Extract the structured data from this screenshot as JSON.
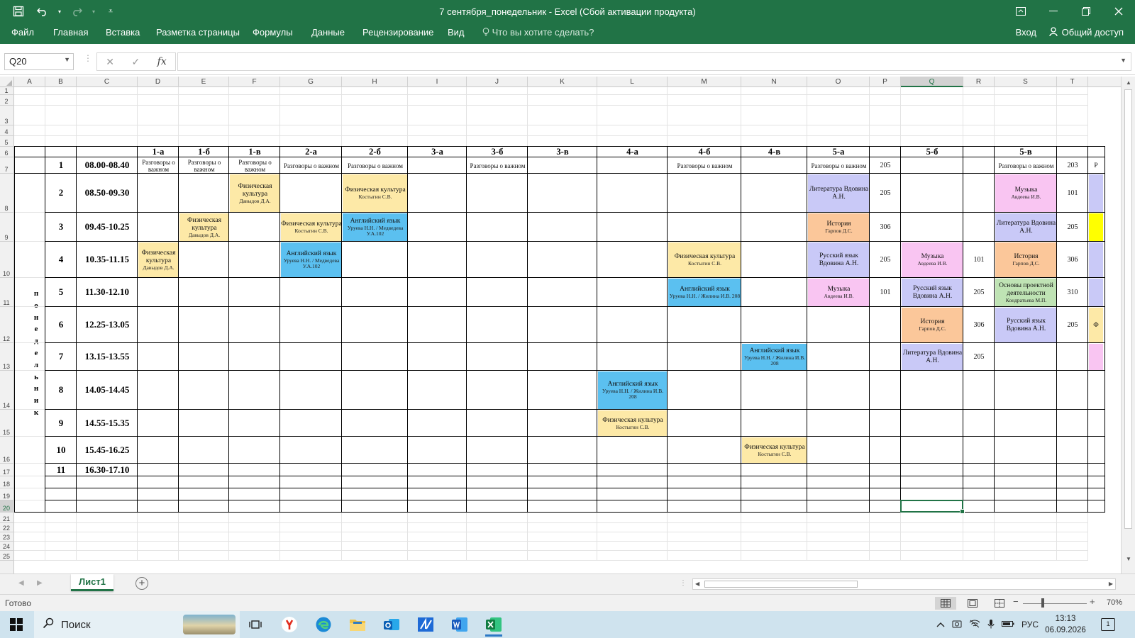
{
  "window": {
    "title": "7 сентября_понедельник - Excel (Сбой активации продукта)"
  },
  "qat": {
    "save_icon": "save-icon",
    "undo_icon": "undo-icon",
    "redo_icon": "redo-icon",
    "customize_icon": "customize-icon"
  },
  "ribbon": {
    "tabs": [
      "Файл",
      "Главная",
      "Вставка",
      "Разметка страницы",
      "Формулы",
      "Данные",
      "Рецензирование",
      "Вид"
    ],
    "tell_me": "Что вы хотите сделать?",
    "signin": "Вход",
    "share": "Общий доступ"
  },
  "formula_bar": {
    "name_box": "Q20",
    "formula": ""
  },
  "columns": [
    "A",
    "B",
    "C",
    "D",
    "E",
    "F",
    "G",
    "H",
    "I",
    "J",
    "K",
    "L",
    "M",
    "N",
    "O",
    "P",
    "Q",
    "R",
    "S",
    "T"
  ],
  "selected_column": "Q",
  "rows": [
    "1",
    "2",
    "3",
    "4",
    "5",
    "6",
    "7",
    "8",
    "9",
    "10",
    "11",
    "12",
    "13",
    "14",
    "15",
    "16",
    "17",
    "18",
    "19",
    "20",
    "21",
    "22",
    "23",
    "24",
    "25"
  ],
  "selected_row": "20",
  "schedule": {
    "day_label": "понедельник",
    "classes": [
      {
        "col": "D",
        "label": "1-а"
      },
      {
        "col": "E",
        "label": "1-б"
      },
      {
        "col": "F",
        "label": "1-в"
      },
      {
        "col": "G",
        "label": "2-а"
      },
      {
        "col": "H",
        "label": "2-б"
      },
      {
        "col": "I",
        "label": "3-а"
      },
      {
        "col": "J",
        "label": "3-б"
      },
      {
        "col": "K",
        "label": "3-в"
      },
      {
        "col": "L",
        "label": "4-а"
      },
      {
        "col": "M",
        "label": "4-б"
      },
      {
        "col": "N",
        "label": "4-в"
      },
      {
        "col": "O",
        "label": "5-а"
      },
      {
        "col": "Q",
        "label": "5-б"
      },
      {
        "col": "S",
        "label": "5-в"
      }
    ],
    "periods": [
      {
        "row": 7,
        "num": "1",
        "time": "08.00-08.40"
      },
      {
        "row": 8,
        "num": "2",
        "time": "08.50-09.30"
      },
      {
        "row": 9,
        "num": "3",
        "time": "09.45-10.25"
      },
      {
        "row": 10,
        "num": "4",
        "time": "10.35-11.15"
      },
      {
        "row": 11,
        "num": "5",
        "time": "11.30-12.10"
      },
      {
        "row": 12,
        "num": "6",
        "time": "12.25-13.05"
      },
      {
        "row": 13,
        "num": "7",
        "time": "13.15-13.55"
      },
      {
        "row": 14,
        "num": "8",
        "time": "14.05-14.45"
      },
      {
        "row": 15,
        "num": "9",
        "time": "14.55-15.35"
      },
      {
        "row": 16,
        "num": "10",
        "time": "15.45-16.25"
      },
      {
        "row": 17,
        "num": "11",
        "time": "16.30-17.10"
      }
    ],
    "lessons": [
      {
        "row": 7,
        "col": "D",
        "title": "Разговоры о важном",
        "sub": "",
        "color": "#ffffff"
      },
      {
        "row": 7,
        "col": "E",
        "title": "Разговоры о важном",
        "sub": "",
        "color": "#ffffff"
      },
      {
        "row": 7,
        "col": "F",
        "title": "Разговоры о важном",
        "sub": "",
        "color": "#ffffff"
      },
      {
        "row": 7,
        "col": "G",
        "title": "Разговоры о важном",
        "sub": "",
        "color": "#ffffff"
      },
      {
        "row": 7,
        "col": "H",
        "title": "Разговоры о важном",
        "sub": "",
        "color": "#ffffff"
      },
      {
        "row": 7,
        "col": "J",
        "title": "Разговоры о важном",
        "sub": "",
        "color": "#ffffff"
      },
      {
        "row": 7,
        "col": "M",
        "title": "Разговоры о важном",
        "sub": "",
        "color": "#ffffff"
      },
      {
        "row": 7,
        "col": "O",
        "title": "Разговоры о важном",
        "sub": "",
        "color": "#ffffff"
      },
      {
        "row": 7,
        "col": "S",
        "title": "Разговоры о важном",
        "sub": "",
        "color": "#ffffff"
      },
      {
        "row": 8,
        "col": "F",
        "title": "Физическая культура",
        "sub": "Давыдов Д.А.",
        "color": "#fde9a7"
      },
      {
        "row": 8,
        "col": "H",
        "title": "Физическая культура",
        "sub": "Костыгин С.В.",
        "color": "#fde9a7"
      },
      {
        "row": 8,
        "col": "O",
        "title": "Литература Вдовина А.Н.",
        "sub": "",
        "color": "#c9c9f7"
      },
      {
        "row": 8,
        "col": "S",
        "title": "Музыка",
        "sub": "Авдеева И.В.",
        "color": "#f9c5f2"
      },
      {
        "row": 9,
        "col": "E",
        "title": "Физическая культура",
        "sub": "Давыдов Д.А.",
        "color": "#fde9a7"
      },
      {
        "row": 9,
        "col": "G",
        "title": "Физическая культура",
        "sub": "Костыгин С.В.",
        "color": "#fde9a7"
      },
      {
        "row": 9,
        "col": "H",
        "title": "Английский язык",
        "sub": "Уруева Н.Н. / Медведева У.А.102",
        "color": "#5bc0f0"
      },
      {
        "row": 9,
        "col": "O",
        "title": "История",
        "sub": "Гарпов Д.С.",
        "color": "#fbc79a"
      },
      {
        "row": 9,
        "col": "S",
        "title": "Литература Вдовина А.Н.",
        "sub": "",
        "color": "#c9c9f7"
      },
      {
        "row": 10,
        "col": "D",
        "title": "Физическая культура",
        "sub": "Давыдов Д.А.",
        "color": "#fde9a7"
      },
      {
        "row": 10,
        "col": "G",
        "title": "Английский язык",
        "sub": "Уруева Н.Н. / Медведева У.А.102",
        "color": "#5bc0f0"
      },
      {
        "row": 10,
        "col": "M",
        "title": "Физическая культура",
        "sub": "Костыгин С.В.",
        "color": "#fde9a7"
      },
      {
        "row": 10,
        "col": "O",
        "title": "Русский язык Вдовина А.Н.",
        "sub": "",
        "color": "#c9c9f7"
      },
      {
        "row": 10,
        "col": "Q",
        "title": "Музыка",
        "sub": "Авдеева И.В.",
        "color": "#f9c5f2"
      },
      {
        "row": 10,
        "col": "S",
        "title": "История",
        "sub": "Гарпов Д.С.",
        "color": "#fbc79a"
      },
      {
        "row": 11,
        "col": "M",
        "title": "Английский язык",
        "sub": "Уруева Н.Н. / Жилина И.В. 208",
        "color": "#5bc0f0"
      },
      {
        "row": 11,
        "col": "O",
        "title": "Музыка",
        "sub": "Авдеева И.В.",
        "color": "#f9c5f2"
      },
      {
        "row": 11,
        "col": "Q",
        "title": "Русский язык Вдовина А.Н.",
        "sub": "",
        "color": "#c9c9f7"
      },
      {
        "row": 11,
        "col": "S",
        "title": "Основы проектной деятельности",
        "sub": "Кондратьева М.П.",
        "color": "#bfe3b4"
      },
      {
        "row": 12,
        "col": "Q",
        "title": "История",
        "sub": "Гарпов Д.С.",
        "color": "#fbc79a"
      },
      {
        "row": 12,
        "col": "S",
        "title": "Русский язык Вдовина А.Н.",
        "sub": "",
        "color": "#c9c9f7"
      },
      {
        "row": 13,
        "col": "N",
        "title": "Английский язык",
        "sub": "Уруева Н.Н. / Жилина И.В. 208",
        "color": "#5bc0f0"
      },
      {
        "row": 13,
        "col": "Q",
        "title": "Литература Вдовина А.Н.",
        "sub": "",
        "color": "#c9c9f7"
      },
      {
        "row": 14,
        "col": "L",
        "title": "Английский язык",
        "sub": "Уруева Н.Н. / Жилина И.В. 208",
        "color": "#5bc0f0"
      },
      {
        "row": 15,
        "col": "L",
        "title": "Физическая культура",
        "sub": "Костыгин С.В.",
        "color": "#fde9a7"
      },
      {
        "row": 16,
        "col": "N",
        "title": "Физическая культура",
        "sub": "Костыгин С.В.",
        "color": "#fde9a7"
      }
    ],
    "rooms": [
      {
        "row": 7,
        "col": "P",
        "value": "205"
      },
      {
        "row": 8,
        "col": "P",
        "value": "205"
      },
      {
        "row": 9,
        "col": "P",
        "value": "306"
      },
      {
        "row": 10,
        "col": "P",
        "value": "205"
      },
      {
        "row": 11,
        "col": "P",
        "value": "101"
      },
      {
        "row": 10,
        "col": "R",
        "value": "101"
      },
      {
        "row": 11,
        "col": "R",
        "value": "205"
      },
      {
        "row": 12,
        "col": "R",
        "value": "306"
      },
      {
        "row": 13,
        "col": "R",
        "value": "205"
      },
      {
        "row": 7,
        "col": "T",
        "value": "203"
      },
      {
        "row": 8,
        "col": "T",
        "value": "101"
      },
      {
        "row": 9,
        "col": "T",
        "value": "205"
      },
      {
        "row": 10,
        "col": "T",
        "value": "306"
      },
      {
        "row": 11,
        "col": "T",
        "value": "310"
      },
      {
        "row": 12,
        "col": "T",
        "value": "205"
      }
    ],
    "edge_cells": [
      {
        "row": 7,
        "text": "Р",
        "color": "#ffffff"
      },
      {
        "row": 8,
        "text": "",
        "color": "#c9c9f7"
      },
      {
        "row": 9,
        "text": "",
        "color": "#ffff00"
      },
      {
        "row": 10,
        "text": "",
        "color": "#c9c9f7"
      },
      {
        "row": 11,
        "text": "",
        "color": "#c9c9f7"
      },
      {
        "row": 12,
        "text": "Ф",
        "color": "#fde9a7"
      },
      {
        "row": 13,
        "text": "",
        "color": "#f9c5f2"
      }
    ]
  },
  "sheets": {
    "tabs": [
      "Лист1"
    ],
    "add_icon": "add-sheet-icon"
  },
  "status": {
    "ready": "Готово",
    "zoom": "70%"
  },
  "taskbar": {
    "search_label": "Поиск",
    "lang": "РУС",
    "time": "13:13",
    "date": "06.09.2026",
    "notif_count": "1"
  },
  "colors": {
    "excel_green": "#217346"
  }
}
